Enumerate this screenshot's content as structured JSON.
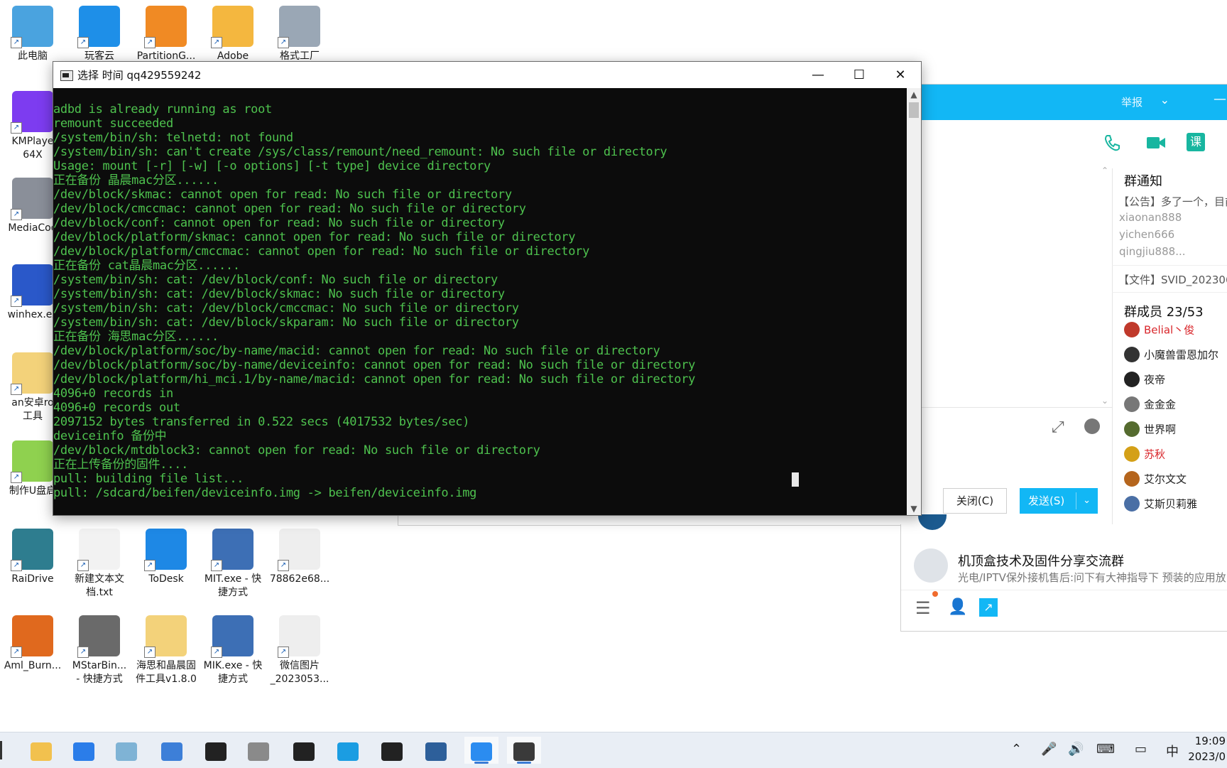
{
  "desktop": {
    "icons": [
      {
        "label": "此电脑",
        "icon": "computer-icon"
      },
      {
        "label": "玩客云",
        "icon": "wankeyun-icon"
      },
      {
        "label": "PartitionG...",
        "icon": "partition-icon"
      },
      {
        "label": "Adobe",
        "icon": "adobe-icon"
      },
      {
        "label": "格式工厂",
        "icon": "format-factory-icon"
      },
      {
        "label": "KMPlaye\n64X",
        "icon": "kmplayer-icon"
      },
      {
        "label": "MediaCod",
        "icon": "mediacoder-icon"
      },
      {
        "label": "winhex.ex",
        "icon": "winhex-icon"
      },
      {
        "label": "an安卓ro\n工具",
        "icon": "folder-icon"
      },
      {
        "label": "制作U盘启",
        "icon": "usb-tool-icon"
      },
      {
        "label": "RaiDrive",
        "icon": "raidrive-icon"
      },
      {
        "label": "新建文本文\n档.txt",
        "icon": "text-file-icon"
      },
      {
        "label": "ToDesk",
        "icon": "todesk-icon"
      },
      {
        "label": "MIT.exe - 快\n捷方式",
        "icon": "tools-icon"
      },
      {
        "label": "78862e68...",
        "icon": "image-file-icon"
      },
      {
        "label": "Aml_Burn...",
        "icon": "aml-burn-icon"
      },
      {
        "label": "MStarBin...\n- 快捷方式",
        "icon": "mstar-icon"
      },
      {
        "label": "海思和晶晨固\n件工具v1.8.0",
        "icon": "folder-icon"
      },
      {
        "label": "MIK.exe - 快\n捷方式",
        "icon": "tools-icon"
      },
      {
        "label": "微信图片\n_2023053...",
        "icon": "image-file-icon"
      }
    ]
  },
  "console": {
    "title": "选择 时间 qq429559242",
    "lines": [
      "adbd is already running as root",
      "remount succeeded",
      "/system/bin/sh: telnetd: not found",
      "/system/bin/sh: can't create /sys/class/remount/need_remount: No such file or directory",
      "Usage: mount [-r] [-w] [-o options] [-t type] device directory",
      "正在备份 晶晨mac分区......",
      "/dev/block/skmac: cannot open for read: No such file or directory",
      "/dev/block/cmccmac: cannot open for read: No such file or directory",
      "/dev/block/conf: cannot open for read: No such file or directory",
      "/dev/block/platform/skmac: cannot open for read: No such file or directory",
      "/dev/block/platform/cmccmac: cannot open for read: No such file or directory",
      "正在备份 cat晶晨mac分区......",
      "/system/bin/sh: cat: /dev/block/conf: No such file or directory",
      "/system/bin/sh: cat: /dev/block/skmac: No such file or directory",
      "/system/bin/sh: cat: /dev/block/cmccmac: No such file or directory",
      "/system/bin/sh: cat: /dev/block/skparam: No such file or directory",
      "正在备份 海思mac分区......",
      "/dev/block/platform/soc/by-name/macid: cannot open for read: No such file or directory",
      "/dev/block/platform/soc/by-name/deviceinfo: cannot open for read: No such file or directory",
      "/dev/block/platform/hi_mci.1/by-name/macid: cannot open for read: No such file or directory",
      "4096+0 records in",
      "4096+0 records out",
      "2097152 bytes transferred in 0.522 secs (4017532 bytes/sec)",
      "deviceinfo 备份中",
      "/dev/block/mtdblock3: cannot open for read: No such file or directory",
      "正在上传备份的固件....",
      "pull: building file list...",
      "pull: /sdcard/beifen/deviceinfo.img -> beifen/deviceinfo.img"
    ],
    "minimize": "—",
    "maximize": "☐",
    "close": "✕"
  },
  "qq": {
    "report": "举报",
    "notice_title": "群通知",
    "notice_lines": [
      "【公告】多了一个，目前",
      "xiaonan888",
      "yichen666",
      "qingjiu888...",
      "【文件】SVID_202306"
    ],
    "members_title": "群成员 23/53",
    "members": [
      {
        "name": "Belial丶俊",
        "red": true,
        "color": "#c0392b"
      },
      {
        "name": "小魔兽雷恩加尔",
        "red": false,
        "color": "#333333"
      },
      {
        "name": "夜帝",
        "red": false,
        "color": "#222222"
      },
      {
        "name": "金金金",
        "red": false,
        "color": "#777777"
      },
      {
        "name": "世界啊",
        "red": false,
        "color": "#556b2f"
      },
      {
        "name": "苏秋",
        "red": true,
        "color": "#d4a017"
      },
      {
        "name": "艾尔文文",
        "red": false,
        "color": "#b5651d"
      },
      {
        "name": "艾斯贝莉雅",
        "red": false,
        "color": "#4a6fa5"
      }
    ],
    "close_button": "关闭(C)",
    "send_button": "发送(S)",
    "group_name": "机顶盒技术及固件分享交流群",
    "group_last_msg": "光电/IPTV保外接机售后:问下有大神指导下   预装的应用放"
  },
  "taskbar": {
    "apps": [
      {
        "name": "file-explorer",
        "color": "#f2c14e"
      },
      {
        "name": "mail",
        "color": "#2b7de9"
      },
      {
        "name": "notepad",
        "color": "#7fb3d5"
      },
      {
        "name": "store",
        "color": "#3d7fd8"
      },
      {
        "name": "qq",
        "color": "#222222"
      },
      {
        "name": "settings-tool",
        "color": "#8a8a8a"
      },
      {
        "name": "hex-tool",
        "color": "#222222"
      },
      {
        "name": "edge",
        "color": "#1b9de2"
      },
      {
        "name": "qq-2",
        "color": "#222222"
      },
      {
        "name": "tools",
        "color": "#2d5f9a"
      },
      {
        "name": "game",
        "color": "#2b8cf0"
      },
      {
        "name": "console",
        "color": "#3a3a3a"
      }
    ],
    "ime": "中",
    "time": "19:09",
    "date": "2023/0"
  }
}
